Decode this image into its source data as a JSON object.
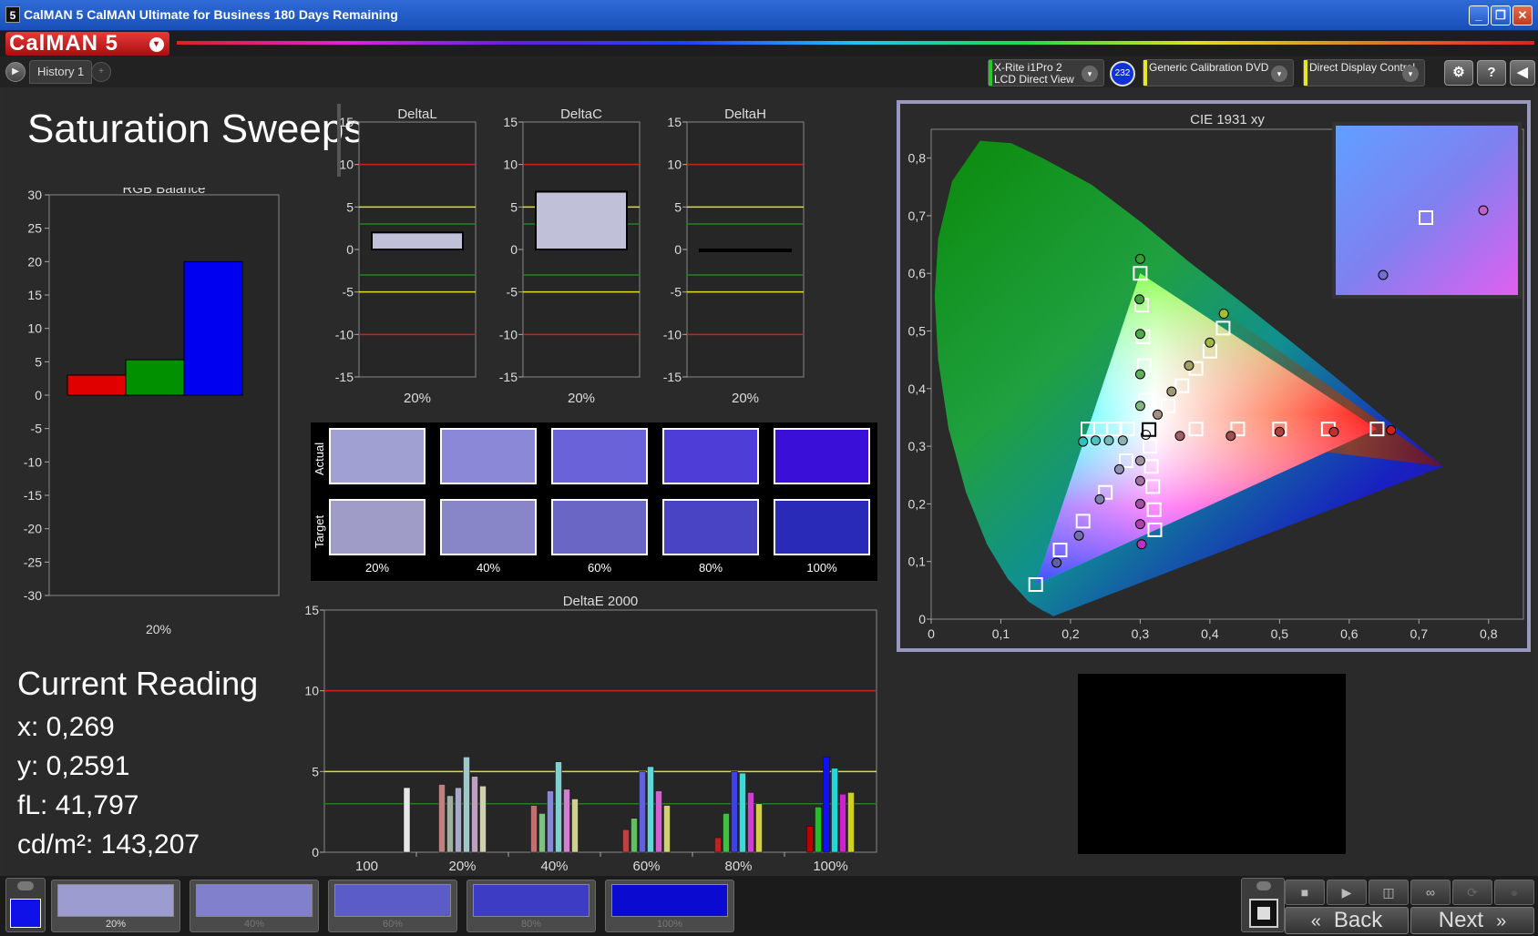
{
  "window": {
    "title": "CalMAN 5 CalMAN Ultimate for Business 180 Days Remaining",
    "app_icon": "5",
    "minimize": "_",
    "restore": "❐",
    "close": "✕"
  },
  "logo": {
    "text": "CalMAN 5",
    "dropdown": "▾"
  },
  "tabs": {
    "play": "▶",
    "history_label": "History 1",
    "add": "+"
  },
  "devices": {
    "meter": {
      "line1": "X-Rite i1Pro 2",
      "line2": "LCD Direct View",
      "color": "#22cc22",
      "badge": "232"
    },
    "source": {
      "label": "Generic Calibration DVD",
      "color": "#e8e820"
    },
    "display": {
      "label": "Direct Display Control",
      "color": "#e8e820"
    },
    "buttons": [
      "⚙",
      "?",
      "◀"
    ]
  },
  "page_title": "Saturation Sweeps",
  "rgb_balance": {
    "title": "RGB Balance",
    "yticks": [
      "30",
      "25",
      "20",
      "15",
      "10",
      "5",
      "0",
      "-5",
      "-10",
      "-15",
      "-20",
      "-25",
      "-30"
    ],
    "xlabel": "20%"
  },
  "current_reading": {
    "heading": "Current Reading",
    "x": "x: 0,269",
    "y": "y: 0,2591",
    "fl": "fL: 41,797",
    "cdm2": "cd/m²: 143,207"
  },
  "delta_charts": {
    "ticks": [
      "15",
      "10",
      "5",
      "0",
      "-5",
      "-10",
      "-15"
    ],
    "items": [
      {
        "title": "DeltaL",
        "xlabel": "20%"
      },
      {
        "title": "DeltaC",
        "xlabel": "20%"
      },
      {
        "title": "DeltaH",
        "xlabel": "20%"
      }
    ]
  },
  "swatches": {
    "actual_label": "Actual",
    "target_label": "Target",
    "labels": [
      "20%",
      "40%",
      "60%",
      "80%",
      "100%"
    ],
    "actual_colors": [
      "#a0a0d2",
      "#8c88d8",
      "#6a62d8",
      "#4f3dd8",
      "#3a10d8"
    ],
    "target_colors": [
      "#a09cc8",
      "#8886c8",
      "#6a66c6",
      "#4844c4",
      "#2a2ab8"
    ]
  },
  "deltae": {
    "title": "DeltaE 2000",
    "yticks": [
      "15",
      "10",
      "5",
      "0"
    ],
    "xlabels": [
      "100",
      "20%",
      "40%",
      "60%",
      "80%",
      "100%"
    ]
  },
  "cie": {
    "title": "CIE 1931 xy",
    "yticks": [
      "0,8",
      "0,7",
      "0,6",
      "0,5",
      "0,4",
      "0,3",
      "0,2",
      "0,1",
      "0"
    ],
    "xticks": [
      "0",
      "0,1",
      "0,2",
      "0,3",
      "0,4",
      "0,5",
      "0,6",
      "0,7",
      "0,8"
    ]
  },
  "bottom": {
    "current_color": "#1010e8",
    "thumbs": [
      {
        "label": "20%",
        "color": "#9c9cd0"
      },
      {
        "label": "40%",
        "color": "#8080cc"
      },
      {
        "label": "60%",
        "color": "#5c5cc8"
      },
      {
        "label": "80%",
        "color": "#3c3cc4"
      },
      {
        "label": "100%",
        "color": "#0a0ad0"
      }
    ],
    "back_label": "Back",
    "next_label": "Next",
    "back_icon": "«",
    "next_icon": "»"
  },
  "chart_data": [
    {
      "type": "bar",
      "title": "RGB Balance",
      "categories": [
        "20%"
      ],
      "series": [
        {
          "name": "",
          "color": "#e00000",
          "values": [
            3
          ]
        },
        {
          "name": "",
          "color": "#009000",
          "values": [
            5.3
          ]
        },
        {
          "name": "",
          "color": "#0000f0",
          "values": [
            20
          ]
        }
      ],
      "ylim": [
        -30,
        30
      ]
    },
    {
      "type": "bar",
      "title": "DeltaL",
      "categories": [
        "20%"
      ],
      "values": [
        2
      ],
      "ylim": [
        -15,
        15
      ],
      "reference_lines": [
        10,
        5,
        3,
        -3,
        -5,
        -10
      ]
    },
    {
      "type": "bar",
      "title": "DeltaC",
      "categories": [
        "20%"
      ],
      "values": [
        6.8
      ],
      "ylim": [
        -15,
        15
      ],
      "reference_lines": [
        10,
        5,
        3,
        -3,
        -5,
        -10
      ]
    },
    {
      "type": "bar",
      "title": "DeltaH",
      "categories": [
        "20%"
      ],
      "values": [
        -0.2
      ],
      "ylim": [
        -15,
        15
      ],
      "reference_lines": [
        10,
        5,
        3,
        -3,
        -5,
        -10
      ]
    },
    {
      "type": "bar",
      "title": "DeltaE 2000",
      "categories": [
        "100",
        "20%",
        "40%",
        "60%",
        "80%",
        "100%"
      ],
      "ylim": [
        0,
        15
      ],
      "reference_lines": [
        10,
        5,
        3
      ],
      "groups": [
        [
          {
            "c": "#e8e8e8",
            "v": 4
          }
        ],
        [
          {
            "c": "#c08080",
            "v": 4.2
          },
          {
            "c": "#a0b0a0",
            "v": 3.5
          },
          {
            "c": "#a8a8c8",
            "v": 4
          },
          {
            "c": "#a0c8c8",
            "v": 5.9
          },
          {
            "c": "#c0a0c0",
            "v": 4.7
          },
          {
            "c": "#d0d0b0",
            "v": 4.1
          }
        ],
        [
          {
            "c": "#c07070",
            "v": 2.9
          },
          {
            "c": "#80c080",
            "v": 2.4
          },
          {
            "c": "#8888d8",
            "v": 3.8
          },
          {
            "c": "#80d0d0",
            "v": 5.6
          },
          {
            "c": "#d080d0",
            "v": 3.9
          },
          {
            "c": "#d0d090",
            "v": 3.3
          }
        ],
        [
          {
            "c": "#c04040",
            "v": 1.4
          },
          {
            "c": "#60c060",
            "v": 2.1
          },
          {
            "c": "#6060e0",
            "v": 5
          },
          {
            "c": "#60d8d8",
            "v": 5.3
          },
          {
            "c": "#d060d0",
            "v": 3.8
          },
          {
            "c": "#d0d070",
            "v": 2.9
          }
        ],
        [
          {
            "c": "#c02020",
            "v": 0.9
          },
          {
            "c": "#40c040",
            "v": 2.4
          },
          {
            "c": "#4040e8",
            "v": 5
          },
          {
            "c": "#40d8d8",
            "v": 4.9
          },
          {
            "c": "#d040d0",
            "v": 3.7
          },
          {
            "c": "#d0d040",
            "v": 3
          }
        ],
        [
          {
            "c": "#c00000",
            "v": 1.6
          },
          {
            "c": "#20c020",
            "v": 2.8
          },
          {
            "c": "#1010f0",
            "v": 5.9
          },
          {
            "c": "#20d8d8",
            "v": 5.2
          },
          {
            "c": "#d020d0",
            "v": 3.6
          },
          {
            "c": "#d0d020",
            "v": 3.7
          }
        ]
      ]
    },
    {
      "type": "scatter",
      "title": "CIE 1931 xy",
      "xlim": [
        0,
        0.85
      ],
      "ylim": [
        0,
        0.85
      ],
      "gamut": [
        [
          0.64,
          0.33
        ],
        [
          0.3,
          0.6
        ],
        [
          0.15,
          0.06
        ]
      ],
      "white": [
        0.3127,
        0.329
      ],
      "targets": [
        [
          0.3,
          0.6
        ],
        [
          0.302,
          0.545
        ],
        [
          0.304,
          0.49
        ],
        [
          0.306,
          0.44
        ],
        [
          0.308,
          0.38
        ],
        [
          0.419,
          0.505
        ],
        [
          0.4,
          0.465
        ],
        [
          0.38,
          0.435
        ],
        [
          0.36,
          0.405
        ],
        [
          0.34,
          0.37
        ],
        [
          0.64,
          0.33
        ],
        [
          0.57,
          0.33
        ],
        [
          0.5,
          0.33
        ],
        [
          0.44,
          0.33
        ],
        [
          0.38,
          0.33
        ],
        [
          0.225,
          0.33
        ],
        [
          0.243,
          0.33
        ],
        [
          0.262,
          0.33
        ],
        [
          0.282,
          0.33
        ],
        [
          0.15,
          0.06
        ],
        [
          0.185,
          0.12
        ],
        [
          0.218,
          0.17
        ],
        [
          0.25,
          0.22
        ],
        [
          0.28,
          0.275
        ],
        [
          0.321,
          0.155
        ],
        [
          0.32,
          0.19
        ],
        [
          0.318,
          0.23
        ],
        [
          0.316,
          0.265
        ],
        [
          0.314,
          0.3
        ]
      ],
      "actual": [
        {
          "c": "#30a030",
          "x": 0.3,
          "y": 0.625
        },
        {
          "c": "#40a040",
          "x": 0.299,
          "y": 0.555
        },
        {
          "c": "#50a850",
          "x": 0.3,
          "y": 0.495
        },
        {
          "c": "#60b060",
          "x": 0.3,
          "y": 0.425
        },
        {
          "c": "#80b880",
          "x": 0.3,
          "y": 0.37
        },
        {
          "c": "#a0c030",
          "x": 0.42,
          "y": 0.53
        },
        {
          "c": "#a0b840",
          "x": 0.4,
          "y": 0.48
        },
        {
          "c": "#a0a060",
          "x": 0.37,
          "y": 0.44
        },
        {
          "c": "#a09870",
          "x": 0.345,
          "y": 0.395
        },
        {
          "c": "#a09080",
          "x": 0.325,
          "y": 0.355
        },
        {
          "c": "#d02020",
          "x": 0.66,
          "y": 0.328
        },
        {
          "c": "#c03030",
          "x": 0.578,
          "y": 0.325
        },
        {
          "c": "#b04040",
          "x": 0.5,
          "y": 0.325
        },
        {
          "c": "#a05050",
          "x": 0.43,
          "y": 0.318
        },
        {
          "c": "#a06060",
          "x": 0.357,
          "y": 0.318
        },
        {
          "c": "#30c0c0",
          "x": 0.218,
          "y": 0.308
        },
        {
          "c": "#50c0c0",
          "x": 0.236,
          "y": 0.31
        },
        {
          "c": "#70b8b8",
          "x": 0.255,
          "y": 0.31
        },
        {
          "c": "#90b0b0",
          "x": 0.275,
          "y": 0.31
        },
        {
          "c": "#6060a0",
          "x": 0.18,
          "y": 0.098
        },
        {
          "c": "#7070a8",
          "x": 0.212,
          "y": 0.145
        },
        {
          "c": "#8080b0",
          "x": 0.242,
          "y": 0.208
        },
        {
          "c": "#9090b0",
          "x": 0.27,
          "y": 0.26
        },
        {
          "c": "#c030c0",
          "x": 0.302,
          "y": 0.13
        },
        {
          "c": "#b040b0",
          "x": 0.3,
          "y": 0.165
        },
        {
          "c": "#a050a0",
          "x": 0.3,
          "y": 0.2
        },
        {
          "c": "#a070a0",
          "x": 0.3,
          "y": 0.24
        },
        {
          "c": "#a090a0",
          "x": 0.3,
          "y": 0.275
        },
        {
          "c": "#ffffff",
          "x": 0.308,
          "y": 0.32
        }
      ]
    }
  ]
}
